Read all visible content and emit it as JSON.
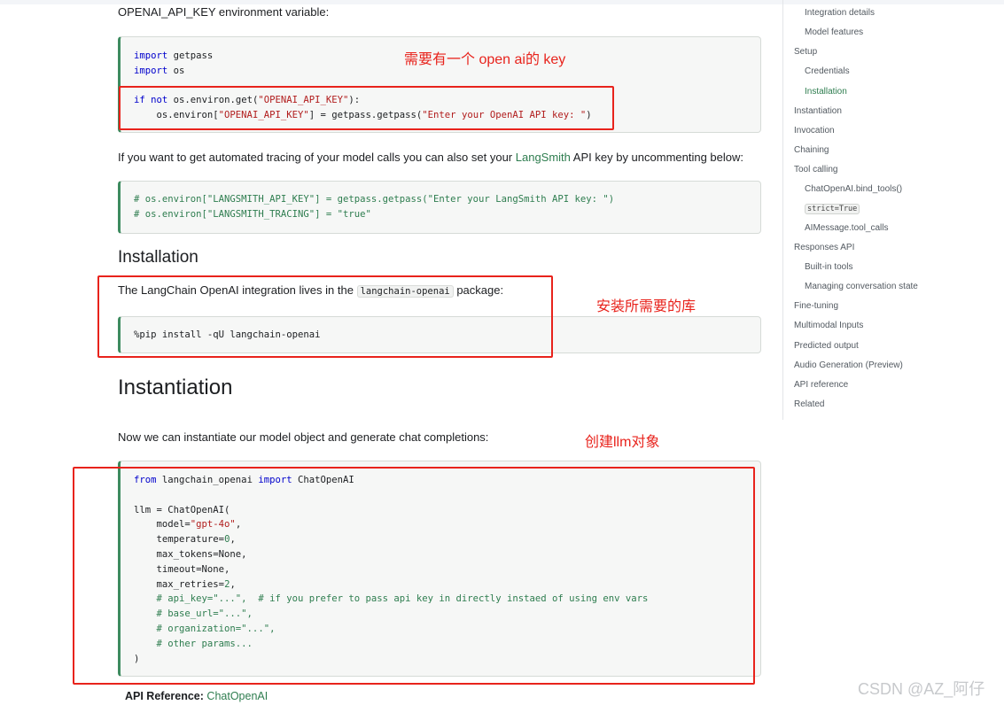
{
  "intro_text": "OPENAI_API_KEY environment variable:",
  "code1": {
    "l1_kw": "import",
    "l1_rest": " getpass",
    "l2_kw": "import",
    "l2_rest": " os",
    "l4_kw1": "if",
    "l4_kw2": "not",
    "l4_mid": " os.environ.get(",
    "l4_str": "\"OPENAI_API_KEY\"",
    "l4_end": "):",
    "l5_a": "    os.environ[",
    "l5_str": "\"OPENAI_API_KEY\"",
    "l5_b": "] = getpass.getpass(",
    "l5_str2": "\"Enter your OpenAI API key: \"",
    "l5_end": ")"
  },
  "annotation1": "需要有一个 open ai的 key",
  "tracing_text": {
    "before": "If you want to get automated tracing of your model calls you can also set your ",
    "link": "LangSmith",
    "after": " API key by uncommenting below:"
  },
  "code2": {
    "l1": "# os.environ[\"LANGSMITH_API_KEY\"] = getpass.getpass(\"Enter your LangSmith API key: \")",
    "l2": "# os.environ[\"LANGSMITH_TRACING\"] = \"true\""
  },
  "installation_heading": "Installation",
  "install_text": {
    "before": "The LangChain OpenAI integration lives in the ",
    "code": "langchain-openai",
    "after": " package:"
  },
  "annotation2": "安装所需要的库",
  "code3": "%pip install -qU langchain-openai",
  "instantiation_heading": "Instantiation",
  "instantiate_text": "Now we can instantiate our model object and generate chat completions:",
  "annotation3": "创建llm对象",
  "code4": {
    "l1_kw": "from",
    "l1_mid": " langchain_openai ",
    "l1_kw2": "import",
    "l1_end": " ChatOpenAI",
    "l3": "llm = ChatOpenAI(",
    "l4_a": "    model=",
    "l4_str": "\"gpt-4o\"",
    "l4_b": ",",
    "l5_a": "    temperature=",
    "l5_num": "0",
    "l5_b": ",",
    "l6": "    max_tokens=None,",
    "l7": "    timeout=None,",
    "l8_a": "    max_retries=",
    "l8_num": "2",
    "l8_b": ",",
    "l9": "    # api_key=\"...\",  # if you prefer to pass api key in directly instaed of using env vars",
    "l10": "    # base_url=\"...\",",
    "l11": "    # organization=\"...\",",
    "l12": "    # other params...",
    "l13": ")"
  },
  "api_reference": {
    "label": "API Reference:",
    "link": "ChatOpenAI"
  },
  "toc": {
    "integration_details": "Integration details",
    "model_features": "Model features",
    "setup": "Setup",
    "credentials": "Credentials",
    "installation": "Installation",
    "instantiation": "Instantiation",
    "invocation": "Invocation",
    "chaining": "Chaining",
    "tool_calling": "Tool calling",
    "bind_tools": "ChatOpenAI.bind_tools()",
    "strict": "strict=True",
    "tool_calls": "AIMessage.tool_calls",
    "responses_api": "Responses API",
    "built_in_tools": "Built-in tools",
    "conversation_state": "Managing conversation state",
    "fine_tuning": "Fine-tuning",
    "multimodal": "Multimodal Inputs",
    "predicted_output": "Predicted output",
    "audio_generation": "Audio Generation (Preview)",
    "api_reference": "API reference",
    "related": "Related"
  },
  "watermark": "CSDN @AZ_阿仔",
  "colors": {
    "annotation": "#e8231c",
    "link": "#2e7d4f",
    "code_accent": "#3d8b5f"
  }
}
